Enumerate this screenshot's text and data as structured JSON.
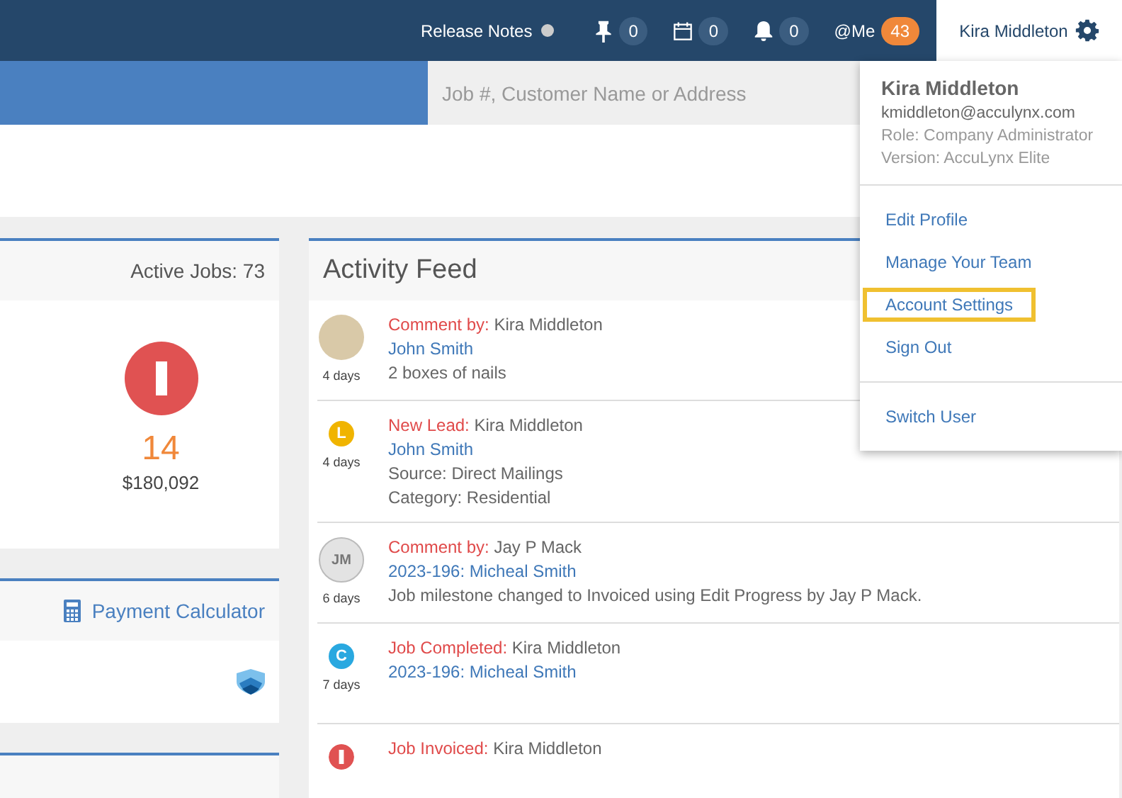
{
  "top_bar": {
    "release_notes": "Release Notes",
    "counters": [
      {
        "kind": "pin",
        "count": "0"
      },
      {
        "kind": "calendar",
        "count": "0"
      },
      {
        "kind": "bell",
        "count": "0"
      }
    ],
    "mentions": {
      "label": "@Me",
      "count": "43"
    },
    "user_name": "Kira Middleton"
  },
  "search": {
    "placeholder": "Job #, Customer Name or Address"
  },
  "user_menu": {
    "name": "Kira Middleton",
    "email": "kmiddleton@acculynx.com",
    "role": "Role: Company Administrator",
    "version": "Version: AccuLynx Elite",
    "items": [
      {
        "label": "Edit Profile",
        "selected": false
      },
      {
        "label": "Manage Your Team",
        "selected": false
      },
      {
        "label": "Account Settings",
        "selected": true
      },
      {
        "label": "Sign Out",
        "selected": false
      }
    ],
    "switch_user": "Switch User"
  },
  "jobs_panel": {
    "active_jobs": "Active Jobs: 73",
    "count": "14",
    "amount": "$180,092"
  },
  "calculator_panel": {
    "link": "Payment Calculator"
  },
  "activity_feed": {
    "title": "Activity Feed",
    "items": [
      {
        "kind": "photo",
        "age": "4 days",
        "action": "Comment by:",
        "actor": "Kira Middleton",
        "job": "John Smith",
        "details": [
          "2 boxes of nails"
        ]
      },
      {
        "kind": "letter",
        "letter": "L",
        "color": "#f0b400",
        "age": "4 days",
        "action": "New Lead:",
        "actor": "Kira Middleton",
        "job": "John Smith",
        "details": [
          "Source: Direct Mailings",
          "Category: Residential"
        ]
      },
      {
        "kind": "initials",
        "letter": "JM",
        "age": "6 days",
        "action": "Comment by:",
        "actor": "Jay P Mack",
        "job": "2023-196: Micheal Smith",
        "details": [
          "Job milestone changed to Invoiced using Edit Progress by Jay P Mack."
        ]
      },
      {
        "kind": "letter",
        "letter": "C",
        "color": "#29a8e0",
        "age": "7 days",
        "action": "Job Completed:",
        "actor": "Kira Middleton",
        "job": "2023-196: Micheal Smith"
      },
      {
        "kind": "alert",
        "color": "#e05252",
        "action": "Job Invoiced:",
        "actor": "Kira Middleton"
      }
    ]
  }
}
